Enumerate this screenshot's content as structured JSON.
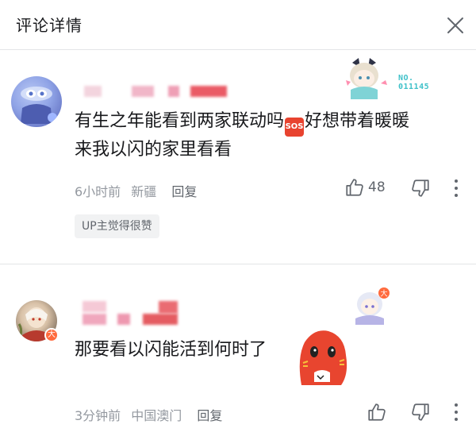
{
  "header": {
    "title": "评论详情",
    "close_icon": "close-icon"
  },
  "comments": [
    {
      "avatar_icon": "avatar",
      "decoration": "fan-badge-decoration",
      "fan_number": "NO.\n011145",
      "text_line1": "有生之年能看到两家联动吗",
      "emoji_label": "SOS",
      "text_line1_after": "好想带着暖暖",
      "text_line2": "来我以闪的家里看看",
      "time": "6小时前",
      "location": "新疆",
      "reply_label": "回复",
      "like_count": "48",
      "up_tag": "UP主觉得很赞"
    },
    {
      "avatar_icon": "avatar",
      "badge": "大",
      "decoration": "chibi-decoration",
      "text": "那要看以闪能活到何时了",
      "time": "3分钟前",
      "location": "中国澳门",
      "reply_label": "回复",
      "like_count": ""
    }
  ],
  "colors": {
    "accent": "#fb7299",
    "text_primary": "#18191c",
    "text_secondary": "#9499a0",
    "divider": "#e3e5e7"
  }
}
